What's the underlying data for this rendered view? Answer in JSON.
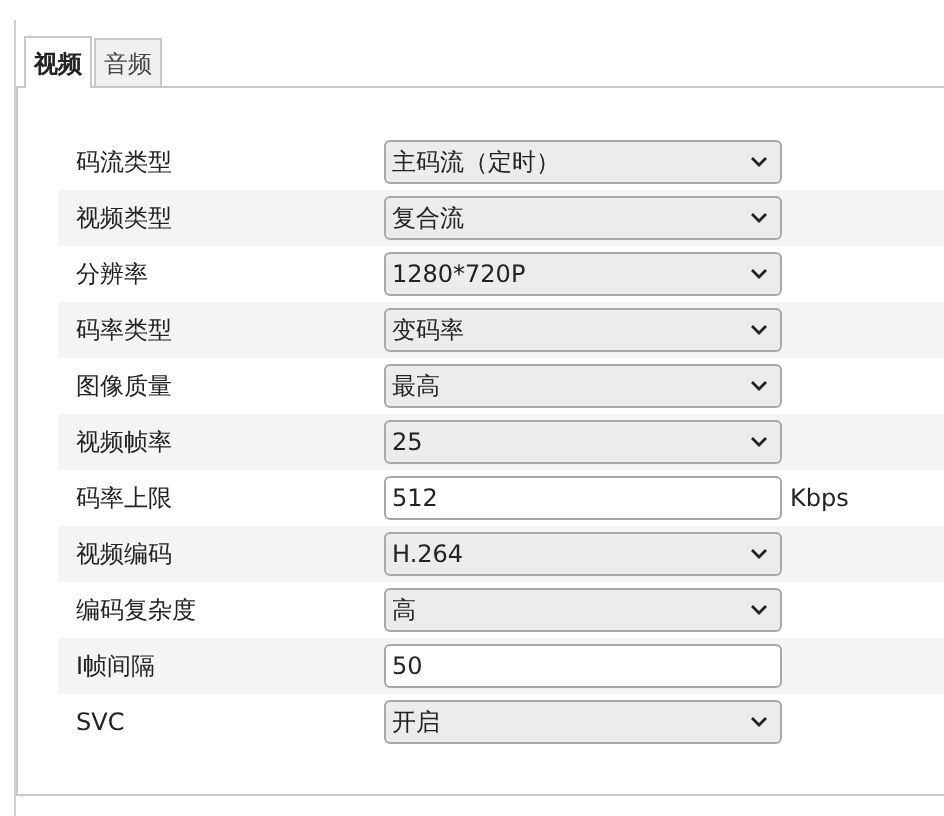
{
  "tabs": [
    {
      "label": "视频",
      "selected": true
    },
    {
      "label": "音频",
      "selected": false
    }
  ],
  "fields": [
    {
      "label": "码流类型",
      "kind": "select",
      "value": "主码流（定时）"
    },
    {
      "label": "视频类型",
      "kind": "select",
      "value": "复合流"
    },
    {
      "label": "分辨率",
      "kind": "select",
      "value": "1280*720P"
    },
    {
      "label": "码率类型",
      "kind": "select",
      "value": "变码率"
    },
    {
      "label": "图像质量",
      "kind": "select",
      "value": "最高"
    },
    {
      "label": "视频帧率",
      "kind": "select",
      "value": "25"
    },
    {
      "label": "码率上限",
      "kind": "input",
      "value": "512",
      "unit": "Kbps"
    },
    {
      "label": "视频编码",
      "kind": "select",
      "value": "H.264"
    },
    {
      "label": "编码复杂度",
      "kind": "select",
      "value": "高"
    },
    {
      "label": "I帧间隔",
      "kind": "input",
      "value": "50"
    },
    {
      "label": "SVC",
      "kind": "select",
      "value": "开启"
    }
  ]
}
